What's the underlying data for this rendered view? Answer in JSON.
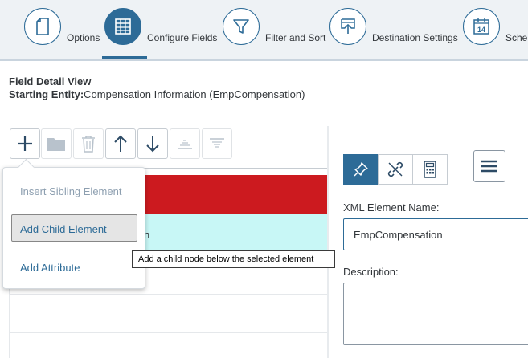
{
  "wizard": {
    "steps": [
      {
        "label": "Options",
        "icon": "document-icon",
        "active": false
      },
      {
        "label": "Configure Fields",
        "icon": "table-grid-icon",
        "active": true
      },
      {
        "label": "Filter and Sort",
        "icon": "filter-funnel-icon",
        "active": false
      },
      {
        "label": "Destination Settings",
        "icon": "upload-tray-icon",
        "active": false
      },
      {
        "label": "Sche",
        "icon": "calendar-14-icon",
        "active": false
      }
    ],
    "calendar_day": "14"
  },
  "header": {
    "title": "Field Detail View",
    "entity_label": "Starting Entity:",
    "entity_value": "Compensation Information (EmpCompensation)"
  },
  "toolbar": {
    "buttons": [
      {
        "name": "add",
        "icon": "plus-icon",
        "enabled": true
      },
      {
        "name": "folder",
        "icon": "folder-icon",
        "enabled": false
      },
      {
        "name": "delete",
        "icon": "trash-icon",
        "enabled": false
      },
      {
        "name": "move-up",
        "icon": "arrow-up-icon",
        "enabled": true
      },
      {
        "name": "move-down",
        "icon": "arrow-down-icon",
        "enabled": true
      },
      {
        "name": "align-bottom",
        "icon": "align-bottom-icon",
        "enabled": false
      },
      {
        "name": "align-top",
        "icon": "align-top-icon",
        "enabled": false
      }
    ]
  },
  "tree": {
    "selected_row_text_fragment": "n"
  },
  "add_menu": {
    "items": [
      {
        "label": "Insert Sibling Element",
        "enabled": false
      },
      {
        "label": "Add Child Element",
        "enabled": true,
        "focused": true
      },
      {
        "label": "Add Attribute",
        "enabled": true
      }
    ]
  },
  "tooltip": {
    "text": "Add a child node below the selected element"
  },
  "detail": {
    "tabs": [
      {
        "icon": "pin-icon",
        "active": true
      },
      {
        "icon": "unlink-icon",
        "active": false
      },
      {
        "icon": "calculator-icon",
        "active": false
      }
    ],
    "xml_label": "XML Element Name:",
    "xml_value": "EmpCompensation",
    "description_label": "Description:",
    "description_value": ""
  },
  "colors": {
    "accent": "#2d6b97",
    "error_row": "#cc1a1f",
    "selected_row": "#c8f7f6",
    "stepbar_bg": "#eef2f5"
  }
}
